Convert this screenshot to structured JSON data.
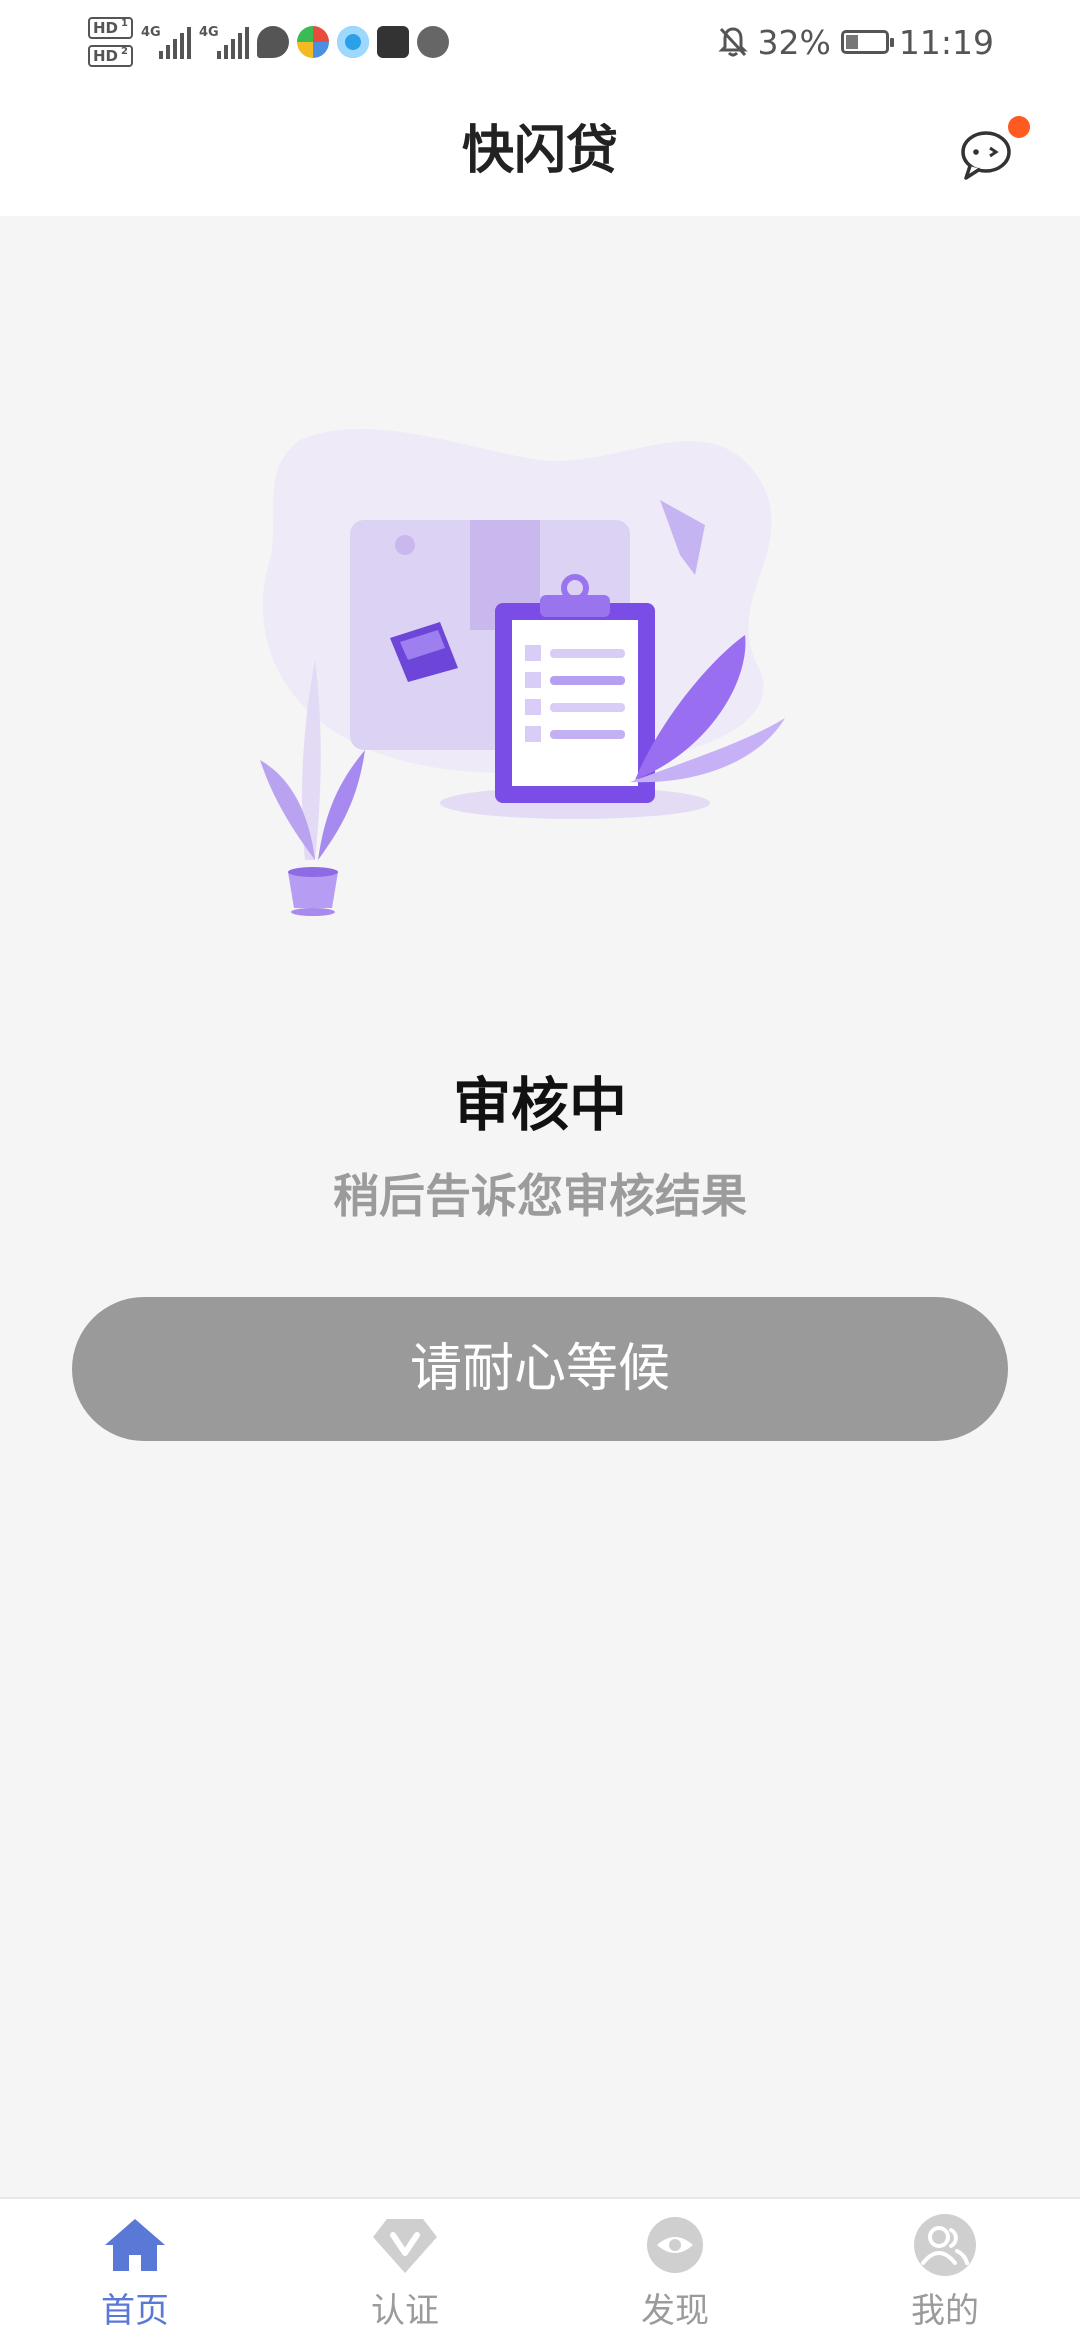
{
  "status_bar": {
    "hd1": "HD",
    "hd1_sub": "1",
    "hd2": "HD",
    "hd2_sub": "2",
    "net1": "4G",
    "net2": "4G",
    "battery_percent": "32%",
    "battery_level": 0.32,
    "time": "11:19"
  },
  "header": {
    "title": "快闪贷",
    "has_unread": true
  },
  "main": {
    "status_title": "审核中",
    "status_subtitle": "稍后告诉您审核结果",
    "wait_button": "请耐心等候"
  },
  "tabs": [
    {
      "label": "首页",
      "icon": "home-icon",
      "active": true
    },
    {
      "label": "认证",
      "icon": "verify-diamond-icon",
      "active": false
    },
    {
      "label": "发现",
      "icon": "discover-eye-icon",
      "active": false
    },
    {
      "label": "我的",
      "icon": "profile-icon",
      "active": false
    }
  ],
  "colors": {
    "accent": "#5a78d6",
    "inactive": "#9b9b9b",
    "button_bg": "#9a9a9a",
    "badge": "#ff5a1f",
    "illustration_purple": "#7a4ee6"
  }
}
